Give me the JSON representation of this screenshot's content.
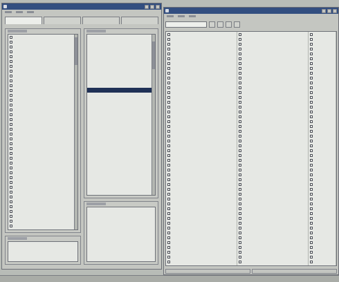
{
  "left_window": {
    "title": "",
    "menu": [
      "",
      "",
      ""
    ],
    "tabs": [
      "",
      "",
      "",
      ""
    ],
    "font_list_selected_row": 11
  },
  "right_window": {
    "title": "",
    "menu": [
      "",
      "",
      ""
    ]
  },
  "colors": {
    "title_bar": "#324e80",
    "selection": "#1f3156",
    "window_face": "#c4c6c1",
    "list_background": "#e6e8e4"
  },
  "icons": [
    "window-icon",
    "minimize-icon",
    "maximize-icon",
    "close-icon"
  ]
}
